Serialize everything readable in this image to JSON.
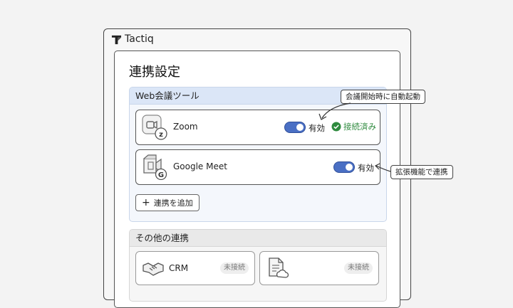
{
  "app": {
    "brand": "Tactiq"
  },
  "page": {
    "title": "連携設定"
  },
  "web_meeting": {
    "header": "Web会議ツール",
    "zoom": {
      "name": "Zoom",
      "toggle_label": "有効",
      "status": "接続済み"
    },
    "meet": {
      "name": "Google Meet",
      "toggle_label": "有効"
    },
    "add_label": "連携を追加"
  },
  "other": {
    "header": "その他の連携",
    "crm": {
      "name": "CRM",
      "status": "未接続"
    },
    "doc": {
      "status": "未接続"
    }
  },
  "callouts": {
    "auto_start": "会議開始時に自動起動",
    "extension": "拡張機能で連携"
  },
  "colors": {
    "accent": "#4a6fc4",
    "connected": "#2e8a3e",
    "section_bg": "#dbe6f7"
  }
}
